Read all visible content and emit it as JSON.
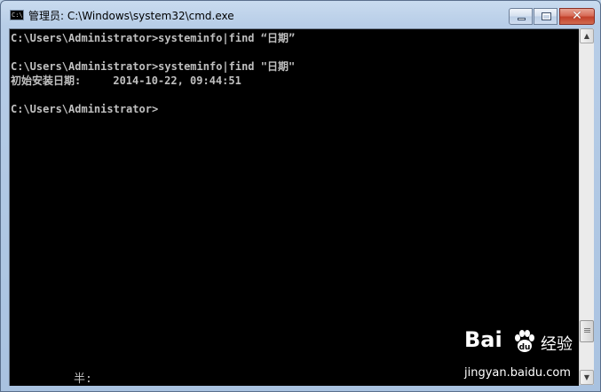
{
  "window": {
    "title": "管理员: C:\\Windows\\system32\\cmd.exe",
    "icon_name": "cmd-icon",
    "icon_label": "C:\\"
  },
  "console": {
    "lines": [
      "C:\\Users\\Administrator>systeminfo|find “日期”",
      "",
      "C:\\Users\\Administrator>systeminfo|find \"日期\"",
      "初始安装日期:     2014-10-22, 09:44:51",
      "",
      "C:\\Users\\Administrator>"
    ],
    "ime_status": "半:",
    "text_color": "#c0c0c0",
    "background": "#000000"
  },
  "watermark": {
    "logo_left": "Bai",
    "logo_right": "经验",
    "url": "jingyan.baidu.com"
  },
  "colors": {
    "title_bar": "#b7cde7",
    "close_button": "#c2412a"
  }
}
